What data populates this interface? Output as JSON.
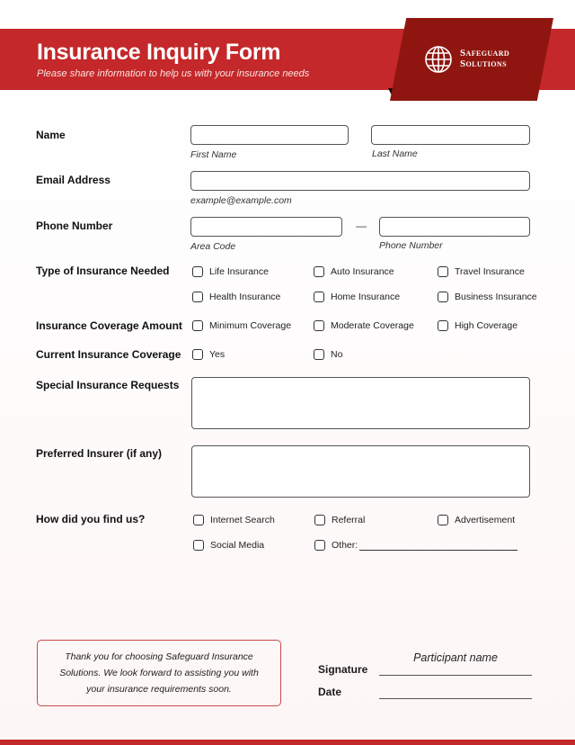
{
  "header": {
    "title": "Insurance Inquiry Form",
    "subtitle": "Please share information to help us with your insurance needs",
    "brand_line1": "Safeguard",
    "brand_line2": "Solutions",
    "logo_icon": "globe-icon",
    "accent_color": "#c4282a",
    "logo_color": "#8f1610"
  },
  "form": {
    "name": {
      "label": "Name",
      "first_hint": "First Name",
      "last_hint": "Last Name",
      "first_value": "",
      "last_value": ""
    },
    "email": {
      "label": "Email Address",
      "hint": "example@example.com",
      "value": ""
    },
    "phone": {
      "label": "Phone Number",
      "separator": "—",
      "area_hint": "Area Code",
      "number_hint": "Phone Number",
      "area_value": "",
      "number_value": ""
    },
    "insurance_type": {
      "label": "Type of Insurance Needed",
      "options": [
        {
          "label": "Life Insurance",
          "checked": false
        },
        {
          "label": "Auto Insurance",
          "checked": false
        },
        {
          "label": "Travel Insurance",
          "checked": false
        },
        {
          "label": "Health Insurance",
          "checked": false
        },
        {
          "label": "Home Insurance",
          "checked": false
        },
        {
          "label": "Business Insurance",
          "checked": false
        }
      ]
    },
    "coverage_amount": {
      "label": "Insurance Coverage Amount",
      "options": [
        {
          "label": "Minimum Coverage",
          "checked": false
        },
        {
          "label": "Moderate Coverage",
          "checked": false
        },
        {
          "label": "High Coverage",
          "checked": false
        }
      ]
    },
    "current_coverage": {
      "label": "Current Insurance Coverage",
      "options": [
        {
          "label": "Yes",
          "checked": false
        },
        {
          "label": "No",
          "checked": false
        }
      ]
    },
    "special_requests": {
      "label": "Special Insurance Requests",
      "value": ""
    },
    "preferred_insurer": {
      "label": "Preferred Insurer (if any)",
      "value": ""
    },
    "find_us": {
      "label": "How did you find us?",
      "options": [
        {
          "label": "Internet Search",
          "checked": false
        },
        {
          "label": "Referral",
          "checked": false
        },
        {
          "label": "Advertisement",
          "checked": false
        },
        {
          "label": "Social Media",
          "checked": false
        },
        {
          "label": "Other:",
          "checked": false
        }
      ],
      "other_value": ""
    }
  },
  "footer": {
    "thank_you": "Thank you for choosing Safeguard Insurance Solutions. We look forward to assisting you with your insurance requirements soon.",
    "signature_label": "Signature",
    "date_label": "Date",
    "participant_name": "Participant name"
  }
}
